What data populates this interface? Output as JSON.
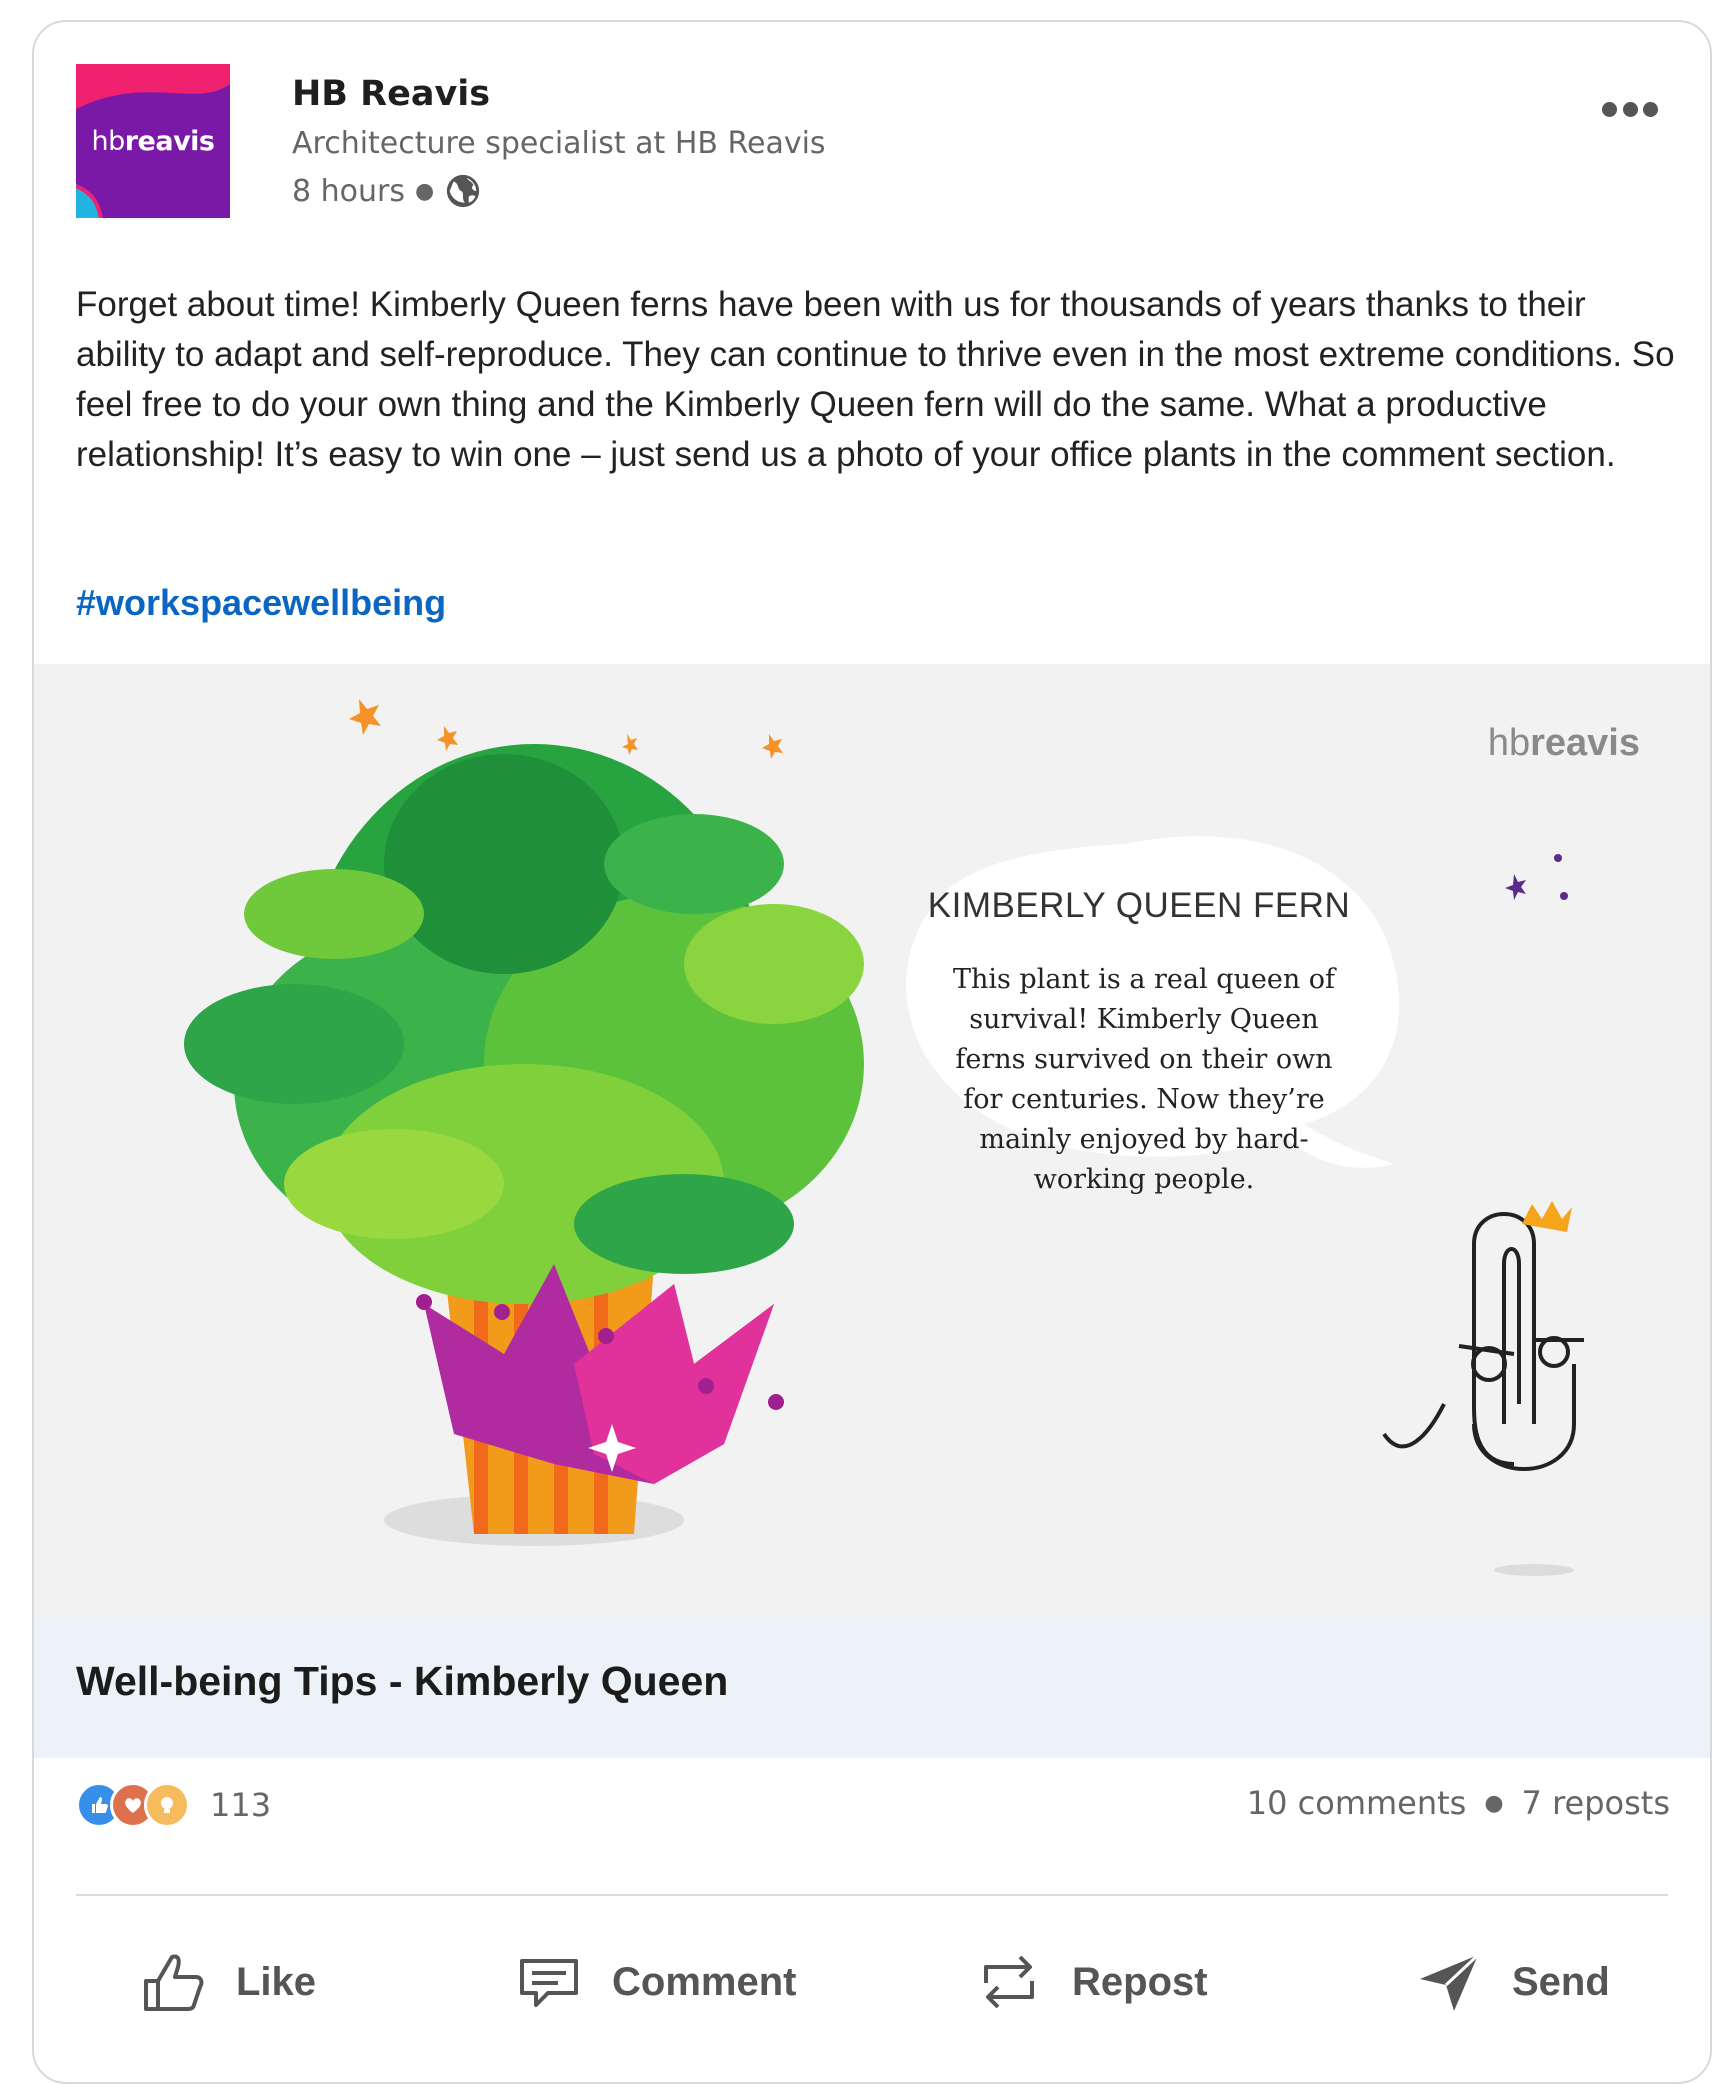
{
  "post": {
    "author": "HB Reavis",
    "subtitle": "Architecture specialist at HB Reavis",
    "time": "8 hours",
    "visibility_icon": "globe-icon",
    "logo": {
      "light": "hb",
      "bold": "reavis"
    },
    "body": "Forget about time! Kimberly Queen ferns have been with us for thousands of years thanks to their ability to adapt and self-reproduce. They can continue to thrive even in the most extreme conditions. So feel free to do your own thing and the Kimberly Queen fern will do the same. What a productive relationship! It’s easy to win one – just send us a photo of your office plants in the comment section.",
    "hashtag": "#workspacewellbeing"
  },
  "media": {
    "watermark": {
      "light": "hb",
      "bold": "reavis"
    },
    "bubble_title": "KIMBERLY QUEEN FERN",
    "bubble_text": "This plant is a real queen of survival! Kimberly Queen ferns survived on their own for centuries. Now they’re mainly enjoyed by hard-working people.",
    "link_title": "Well-being Tips - Kimberly Queen"
  },
  "stats": {
    "reaction_count": "113",
    "reaction_icons": [
      "like-reaction-icon",
      "love-reaction-icon",
      "insightful-reaction-icon"
    ],
    "comments": "10 comments",
    "reposts": "7 reposts"
  },
  "actions": {
    "like": "Like",
    "comment": "Comment",
    "repost": "Repost",
    "send": "Send"
  },
  "colors": {
    "link": "#0a66c2",
    "logo_bg": "#7a19a8",
    "logo_accent": "#f0216e"
  }
}
